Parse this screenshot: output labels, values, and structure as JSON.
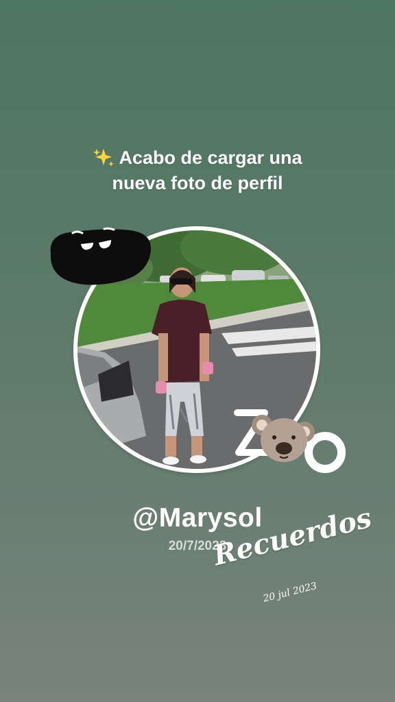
{
  "headline": {
    "icon": "sparkles-icon",
    "line1": "Acabo de cargar una",
    "line2": "nueva foto de perfil"
  },
  "profile_photo": {
    "description_icon": "profile-photo"
  },
  "stickers": {
    "blob": "smiling-blob-sticker",
    "zoo": "zoo-koala-sticker"
  },
  "user": {
    "handle": "@Marysol",
    "date": "20/7/2023"
  },
  "overlay": {
    "script_text": "Recuerdos",
    "script_date": "20 jul 2023"
  },
  "colors": {
    "background_top": "#4d7660",
    "background_bottom": "#7a837e",
    "text": "#ffffff"
  }
}
